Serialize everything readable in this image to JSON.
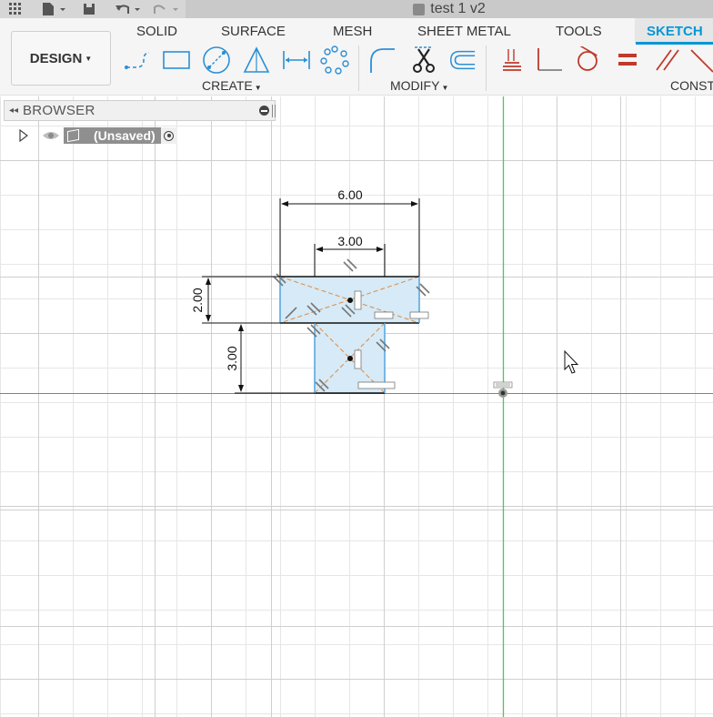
{
  "document": {
    "title": "test 1 v2"
  },
  "workspace": {
    "label": "DESIGN"
  },
  "tabs": [
    {
      "label": "SOLID"
    },
    {
      "label": "SURFACE"
    },
    {
      "label": "MESH"
    },
    {
      "label": "SHEET METAL"
    },
    {
      "label": "TOOLS"
    },
    {
      "label": "SKETCH"
    }
  ],
  "active_tab": "SKETCH",
  "groups": {
    "create": "CREATE",
    "modify": "MODIFY",
    "constraints": "CONST"
  },
  "browser": {
    "title": "BROWSER",
    "root_label": "(Unsaved)"
  },
  "sketch": {
    "dimensions": {
      "top_width": "6.00",
      "bottom_width": "3.00",
      "top_height": "2.00",
      "bottom_height": "3.00"
    }
  },
  "colors": {
    "accent": "#0696d7",
    "x_axis": "#e05a5a",
    "y_axis": "#4cc94c",
    "profile_fill": "#d6eaf7",
    "construction": "#e08a40",
    "grid": "#e6e6e6"
  },
  "icons": {
    "apps": "grid-icon",
    "file": "file-icon",
    "save": "save-icon",
    "undo": "undo-icon",
    "redo": "redo-icon"
  }
}
